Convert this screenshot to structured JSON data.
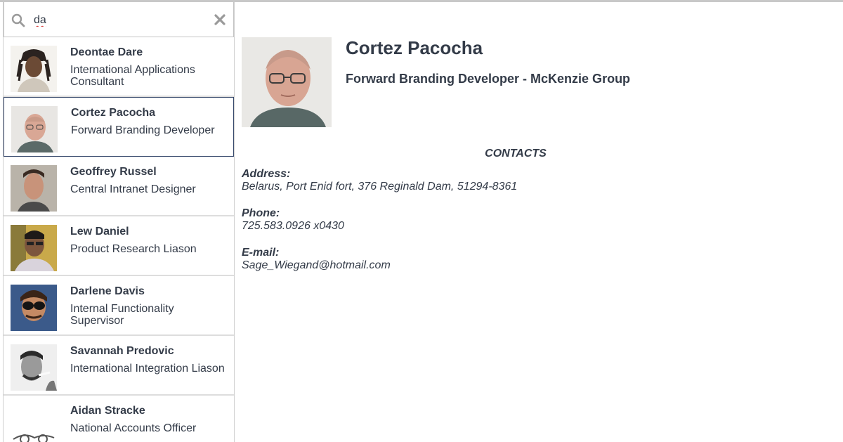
{
  "search": {
    "value": "da",
    "icons": {
      "search": "search-icon",
      "clear": "close-icon"
    }
  },
  "contacts": [
    {
      "name": "Deontae Dare",
      "title": "International Applications Consultant",
      "selected": false
    },
    {
      "name": "Cortez Pacocha",
      "title": "Forward Branding Developer",
      "selected": true
    },
    {
      "name": "Geoffrey Russel",
      "title": "Central Intranet Designer",
      "selected": false
    },
    {
      "name": "Lew Daniel",
      "title": "Product Research Liason",
      "selected": false
    },
    {
      "name": "Darlene Davis",
      "title": "Internal Functionality Supervisor",
      "selected": false
    },
    {
      "name": "Savannah Predovic",
      "title": "International Integration Liason",
      "selected": false
    },
    {
      "name": "Aidan Stracke",
      "title": "National Accounts Officer",
      "selected": false
    }
  ],
  "detail": {
    "name": "Cortez Pacocha",
    "role": "Forward Branding Developer - McKenzie Group",
    "contacts_heading": "CONTACTS",
    "address_label": "Address:",
    "address": "Belarus, Port Enid fort, 376 Reginald Dam, 51294-8361",
    "phone_label": "Phone:",
    "phone": "725.583.0926 x0430",
    "email_label": "E-mail:",
    "email": "Sage_Wiegand@hotmail.com"
  },
  "colors": {
    "text": "#333b48",
    "selected_border": "#35476a",
    "divider": "#dddddd"
  }
}
